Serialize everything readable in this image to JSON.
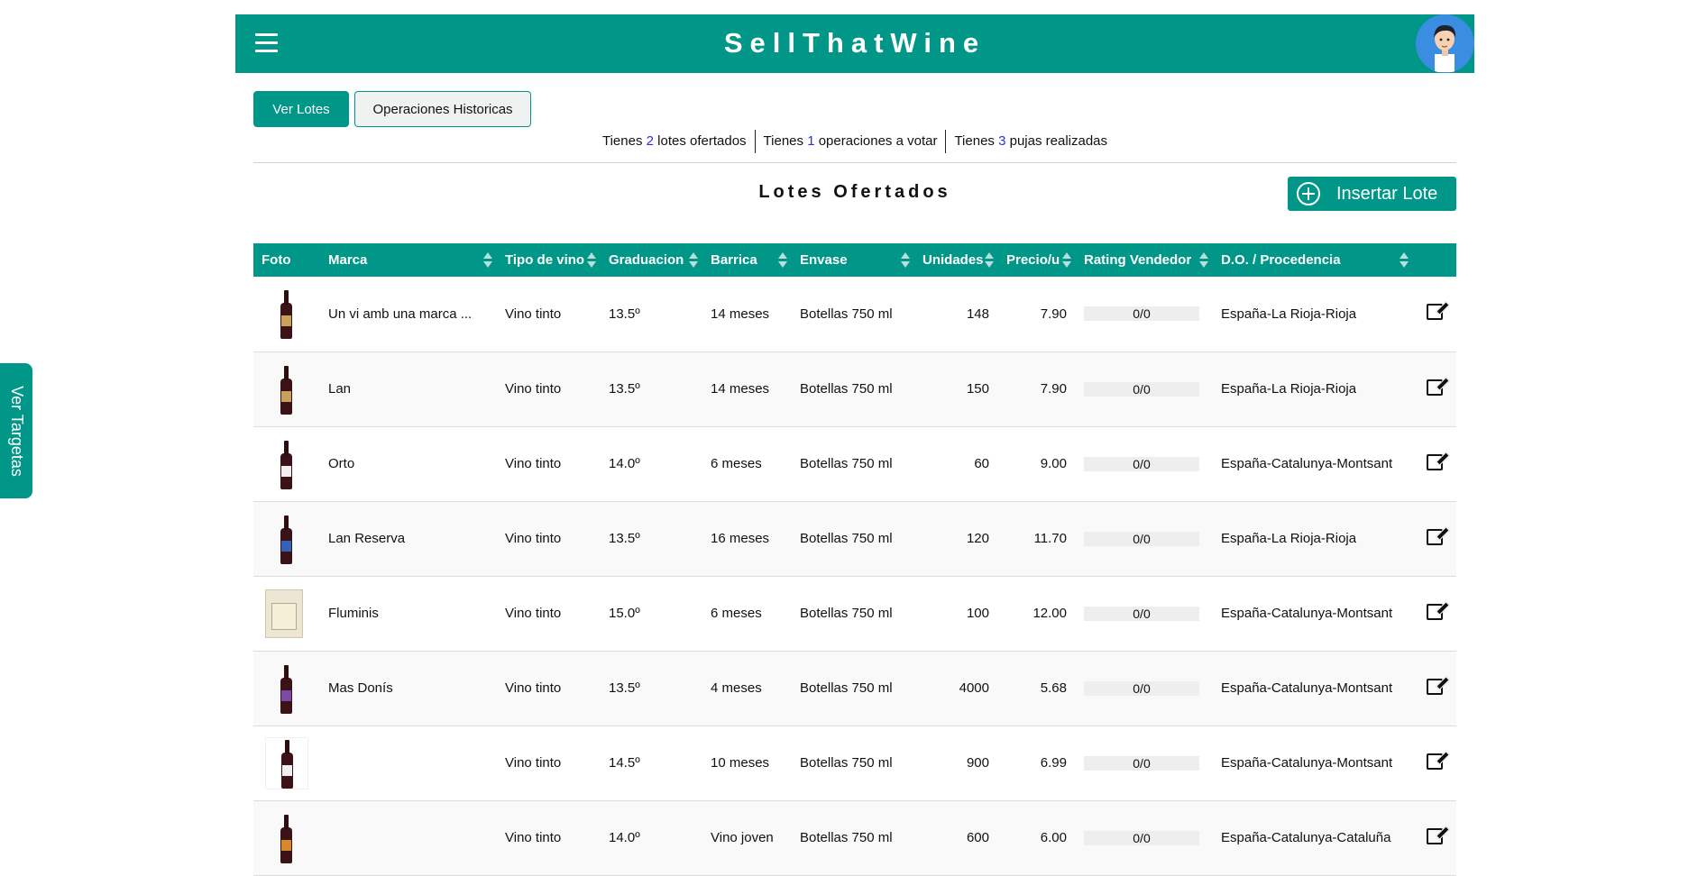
{
  "header": {
    "brand": "SellThatWine"
  },
  "tabs": {
    "active_label": "Ver Lotes",
    "inactive_label": "Operaciones Historicas"
  },
  "summary": {
    "lots": {
      "prefix": "Tienes",
      "count": "2",
      "suffix": "lotes ofertados"
    },
    "ops": {
      "prefix": "Tienes",
      "count": "1",
      "suffix": "operaciones a votar"
    },
    "bids": {
      "prefix": "Tienes",
      "count": "3",
      "suffix": "pujas realizadas"
    }
  },
  "section": {
    "title": "Lotes Ofertados",
    "insert_label": "Insertar Lote"
  },
  "table": {
    "headers": [
      "Foto",
      "Marca",
      "Tipo de vino",
      "Graduacion",
      "Barrica",
      "Envase",
      "Unidades",
      "Precio/u",
      "Rating Vendedor",
      "D.O. / Procedencia"
    ],
    "rows": [
      {
        "bottle": "red",
        "marca": "Un vi amb una marca ...",
        "tipo": "Vino tinto",
        "grad": "13.5º",
        "barrica": "14 meses",
        "envase": "Botellas 750 ml",
        "unidades": "148",
        "precio": "7.90",
        "rating": "0/0",
        "do": "España-La Rioja-Rioja"
      },
      {
        "bottle": "red",
        "marca": "Lan",
        "tipo": "Vino tinto",
        "grad": "13.5º",
        "barrica": "14 meses",
        "envase": "Botellas 750 ml",
        "unidades": "150",
        "precio": "7.90",
        "rating": "0/0",
        "do": "España-La Rioja-Rioja"
      },
      {
        "bottle": "white",
        "marca": "Orto",
        "tipo": "Vino tinto",
        "grad": "14.0º",
        "barrica": "6 meses",
        "envase": "Botellas 750 ml",
        "unidades": "60",
        "precio": "9.00",
        "rating": "0/0",
        "do": "España-Catalunya-Montsant"
      },
      {
        "bottle": "blue",
        "marca": "Lan Reserva",
        "tipo": "Vino tinto",
        "grad": "13.5º",
        "barrica": "16 meses",
        "envase": "Botellas 750 ml",
        "unidades": "120",
        "precio": "11.70",
        "rating": "0/0",
        "do": "España-La Rioja-Rioja"
      },
      {
        "bottle": "box",
        "marca": "Fluminis",
        "tipo": "Vino tinto",
        "grad": "15.0º",
        "barrica": "6 meses",
        "envase": "Botellas 750 ml",
        "unidades": "100",
        "precio": "12.00",
        "rating": "0/0",
        "do": "España-Catalunya-Montsant"
      },
      {
        "bottle": "purple",
        "marca": "Mas Donís",
        "tipo": "Vino tinto",
        "grad": "13.5º",
        "barrica": "4 meses",
        "envase": "Botellas 750 ml",
        "unidades": "4000",
        "precio": "5.68",
        "rating": "0/0",
        "do": "España-Catalunya-Montsant"
      },
      {
        "bottle": "whitebg",
        "marca": "",
        "tipo": "Vino tinto",
        "grad": "14.5º",
        "barrica": "10 meses",
        "envase": "Botellas 750 ml",
        "unidades": "900",
        "precio": "6.99",
        "rating": "0/0",
        "do": "España-Catalunya-Montsant"
      },
      {
        "bottle": "orange",
        "marca": "",
        "tipo": "Vino tinto",
        "grad": "14.0º",
        "barrica": "Vino joven",
        "envase": "Botellas 750 ml",
        "unidades": "600",
        "precio": "6.00",
        "rating": "0/0",
        "do": "España-Catalunya-Cataluña"
      }
    ]
  },
  "side_tab": {
    "label": "Ver Targetas"
  },
  "colors": {
    "primary": "#009688",
    "link_number": "#2f2fd8"
  },
  "icons": [
    "hamburger-icon",
    "avatar",
    "add-circle-icon",
    "sort-icon",
    "edit-icon"
  ]
}
